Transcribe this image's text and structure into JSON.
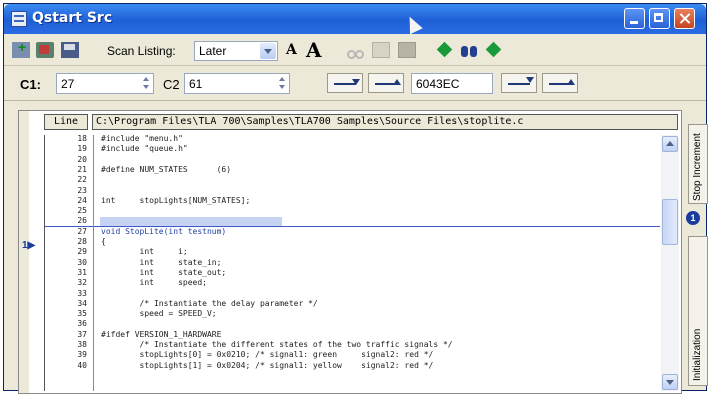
{
  "window": {
    "title": "Qstart Src"
  },
  "toolbar": {
    "scan_label": "Scan Listing:",
    "scan_value": "Later",
    "font_small": "A",
    "font_large": "A"
  },
  "cursors": {
    "c1_label": "C1:",
    "c1_value": "27",
    "c2_label": "C2",
    "c2_value": "61",
    "delta_value": "6043EC"
  },
  "source": {
    "line_header": "Line",
    "path": "C:\\Program Files\\TLA 700\\Samples\\TLA700 Samples\\Source Files\\stoplite.c",
    "current_line": "27",
    "lines": [
      {
        "n": "18",
        "t": "#include \"menu.h\""
      },
      {
        "n": "19",
        "t": "#include \"queue.h\""
      },
      {
        "n": "20",
        "t": ""
      },
      {
        "n": "21",
        "t": "#define NUM_STATES      (6)"
      },
      {
        "n": "22",
        "t": ""
      },
      {
        "n": "23",
        "t": ""
      },
      {
        "n": "24",
        "t": "int     stopLights[NUM_STATES];"
      },
      {
        "n": "25",
        "t": ""
      },
      {
        "n": "26",
        "t": ""
      },
      {
        "n": "27",
        "t": "void StopLite(int testnum)"
      },
      {
        "n": "28",
        "t": "{"
      },
      {
        "n": "29",
        "t": "        int     i;"
      },
      {
        "n": "30",
        "t": "        int     state_in;"
      },
      {
        "n": "31",
        "t": "        int     state_out;"
      },
      {
        "n": "32",
        "t": "        int     speed;"
      },
      {
        "n": "33",
        "t": ""
      },
      {
        "n": "34",
        "t": "        /* Instantiate the delay parameter */"
      },
      {
        "n": "35",
        "t": "        speed = SPEED_V;"
      },
      {
        "n": "36",
        "t": ""
      },
      {
        "n": "37",
        "t": "#ifdef VERSION_1_HARDWARE"
      },
      {
        "n": "38",
        "t": "        /* Instantiate the different states of the two traffic signals */"
      },
      {
        "n": "39",
        "t": "        stopLights[0] = 0x0210; /* signal1: green     signal2: red */"
      },
      {
        "n": "40",
        "t": "        stopLights[1] = 0x0204; /* signal1: yellow    signal2: red */"
      }
    ]
  },
  "side_tabs": {
    "increment": "Stop Increment",
    "initialization": "Initialization",
    "marker": "1"
  }
}
